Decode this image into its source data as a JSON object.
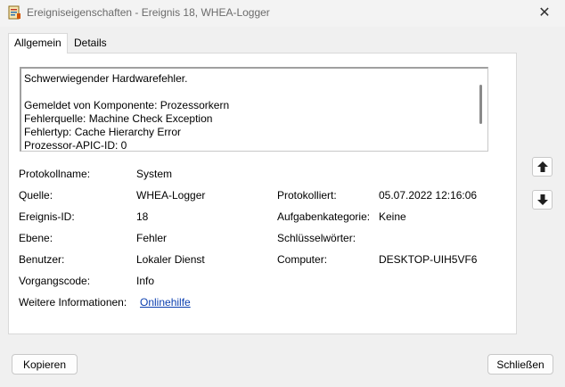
{
  "window": {
    "title": "Ereigniseigenschaften - Ereignis 18, WHEA-Logger",
    "close_glyph": "✕"
  },
  "tabs": [
    {
      "label": "Allgemein"
    },
    {
      "label": "Details"
    }
  ],
  "description": {
    "lines": [
      "Schwerwiegender Hardwarefehler.",
      "",
      "Gemeldet von Komponente: Prozessorkern",
      "Fehlerquelle: Machine Check Exception",
      "Fehlertyp: Cache Hierarchy Error",
      "Prozessor-APIC-ID: 0"
    ]
  },
  "fields": {
    "protokollname": {
      "label": "Protokollname:",
      "value": "System"
    },
    "quelle": {
      "label": "Quelle:",
      "value": "WHEA-Logger"
    },
    "protokolliert": {
      "label": "Protokolliert:",
      "value": "05.07.2022 12:16:06"
    },
    "ereignis_id": {
      "label": "Ereignis-ID:",
      "value": "18"
    },
    "aufgabenkategorie": {
      "label": "Aufgabenkategorie:",
      "value": "Keine"
    },
    "ebene": {
      "label": "Ebene:",
      "value": "Fehler"
    },
    "schluesselwoerter": {
      "label": "Schlüsselwörter:",
      "value": ""
    },
    "benutzer": {
      "label": "Benutzer:",
      "value": "Lokaler Dienst"
    },
    "computer": {
      "label": "Computer:",
      "value": "DESKTOP-UIH5VF6"
    },
    "vorgangscode": {
      "label": "Vorgangscode:",
      "value": "Info"
    },
    "weitere_informationen": {
      "label": "Weitere Informationen:",
      "value": "Onlinehilfe"
    }
  },
  "buttons": {
    "copy": "Kopieren",
    "close": "Schließen"
  },
  "icons": {
    "up": "arrow-up-icon",
    "down": "arrow-down-icon"
  }
}
